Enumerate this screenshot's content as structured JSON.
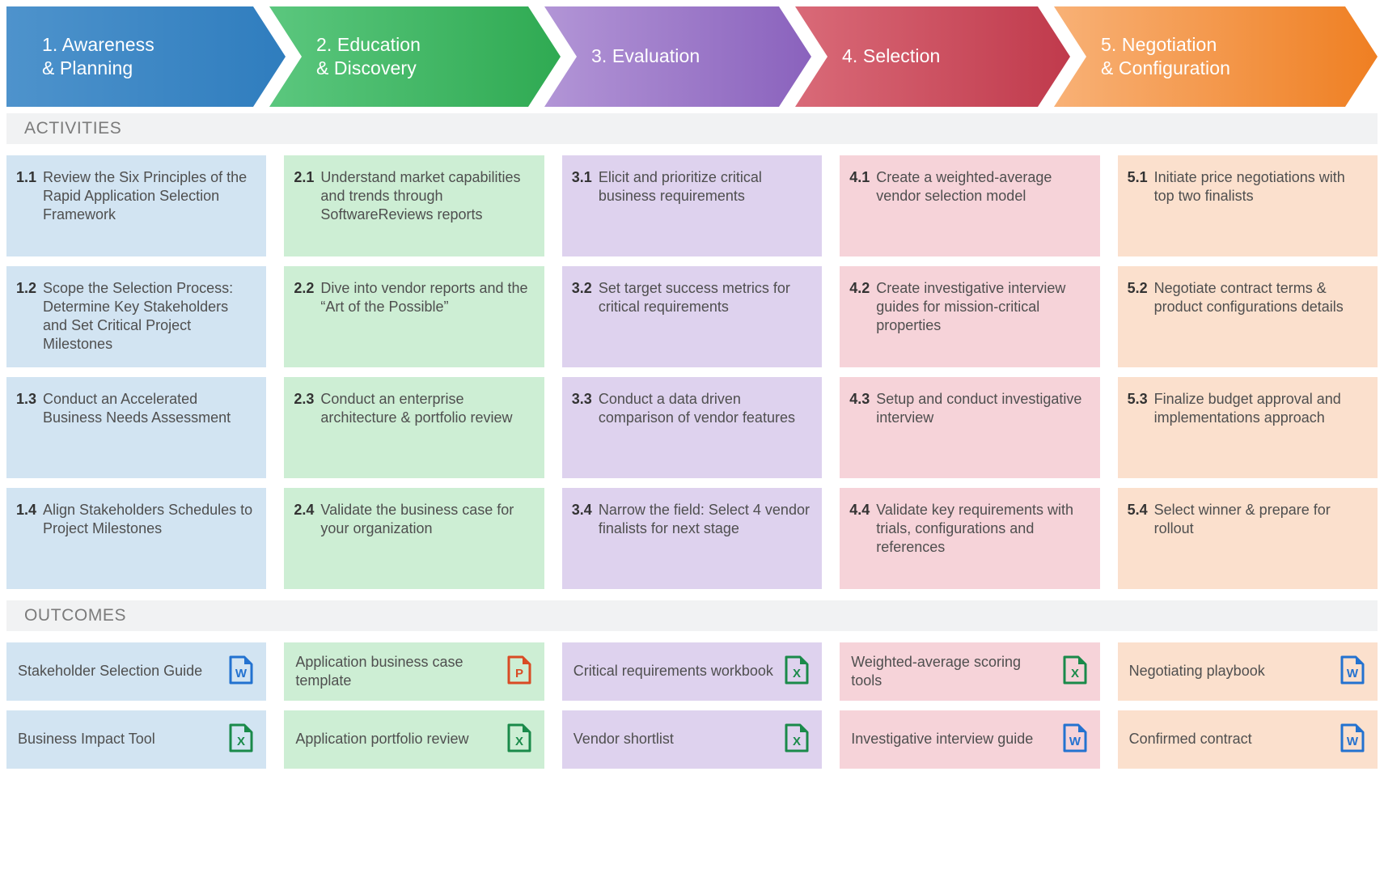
{
  "stages": [
    {
      "label": "1. Awareness\n& Planning",
      "color": "#2f7dbe",
      "tint": "#d2e4f2"
    },
    {
      "label": "2. Education\n& Discovery",
      "color": "#2faa52",
      "tint": "#cdeed4"
    },
    {
      "label": "3. Evaluation",
      "color": "#8a62bd",
      "tint": "#ded2ee"
    },
    {
      "label": "4. Selection",
      "color": "#c03a4c",
      "tint": "#f6d3d9"
    },
    {
      "label": "5. Negotiation\n& Configuration",
      "color": "#ef7f22",
      "tint": "#fbe0cd"
    }
  ],
  "sections": {
    "activities_label": "ACTIVITIES",
    "outcomes_label": "OUTCOMES"
  },
  "activities": [
    [
      {
        "num": "1.1",
        "text": "Review the Six Principles of the Rapid Application Selection Framework"
      },
      {
        "num": "2.1",
        "text": "Understand market capabilities and trends through SoftwareReviews reports"
      },
      {
        "num": "3.1",
        "text": "Elicit and prioritize critical business requirements"
      },
      {
        "num": "4.1",
        "text": "Create a weighted-average vendor selection model"
      },
      {
        "num": "5.1",
        "text": "Initiate price negotiations with top two finalists"
      }
    ],
    [
      {
        "num": "1.2",
        "text": "Scope the Selection Process: Determine Key Stakeholders and Set Critical Project Milestones"
      },
      {
        "num": "2.2",
        "text": "Dive into vendor reports and the “Art of the Possible”"
      },
      {
        "num": "3.2",
        "text": "Set target success metrics for critical requirements"
      },
      {
        "num": "4.2",
        "text": "Create investigative interview guides for mission-critical properties"
      },
      {
        "num": "5.2",
        "text": "Negotiate contract terms & product configurations details"
      }
    ],
    [
      {
        "num": "1.3",
        "text": "Conduct an Accelerated Business Needs Assessment"
      },
      {
        "num": "2.3",
        "text": "Conduct an enterprise architecture & portfolio review"
      },
      {
        "num": "3.3",
        "text": "Conduct a data driven comparison of vendor features"
      },
      {
        "num": "4.3",
        "text": "Setup and conduct investigative interview"
      },
      {
        "num": "5.3",
        "text": "Finalize budget approval and implementations approach"
      }
    ],
    [
      {
        "num": "1.4",
        "text": "Align Stakeholders Schedules to Project Milestones"
      },
      {
        "num": "2.4",
        "text": "Validate the business case for your organization"
      },
      {
        "num": "3.4",
        "text": "Narrow the field: Select 4 vendor finalists for next stage"
      },
      {
        "num": "4.4",
        "text": "Validate key requirements with trials, configurations and references"
      },
      {
        "num": "5.4",
        "text": "Select winner & prepare for rollout"
      }
    ]
  ],
  "outcomes": [
    [
      {
        "text": "Stakeholder Selection Guide",
        "icon": "word-file-icon",
        "icon_letter": "W",
        "icon_color": "#2372d0"
      },
      {
        "text": "Application business case template",
        "icon": "powerpoint-file-icon",
        "icon_letter": "P",
        "icon_color": "#d94b24"
      },
      {
        "text": "Critical requirements workbook",
        "icon": "excel-file-icon",
        "icon_letter": "X",
        "icon_color": "#1a8a4a"
      },
      {
        "text": "Weighted-average scoring tools",
        "icon": "excel-file-icon",
        "icon_letter": "X",
        "icon_color": "#1a8a4a"
      },
      {
        "text": "Negotiating playbook",
        "icon": "word-file-icon",
        "icon_letter": "W",
        "icon_color": "#2372d0"
      }
    ],
    [
      {
        "text": "Business Impact Tool",
        "icon": "excel-file-icon",
        "icon_letter": "X",
        "icon_color": "#1a8a4a"
      },
      {
        "text": "Application portfolio review",
        "icon": "excel-file-icon",
        "icon_letter": "X",
        "icon_color": "#1a8a4a"
      },
      {
        "text": "Vendor shortlist",
        "icon": "excel-file-icon",
        "icon_letter": "X",
        "icon_color": "#1a8a4a"
      },
      {
        "text": "Investigative interview guide",
        "icon": "word-file-icon",
        "icon_letter": "W",
        "icon_color": "#2372d0"
      },
      {
        "text": "Confirmed contract",
        "icon": "word-file-icon",
        "icon_letter": "W",
        "icon_color": "#2372d0"
      }
    ]
  ]
}
